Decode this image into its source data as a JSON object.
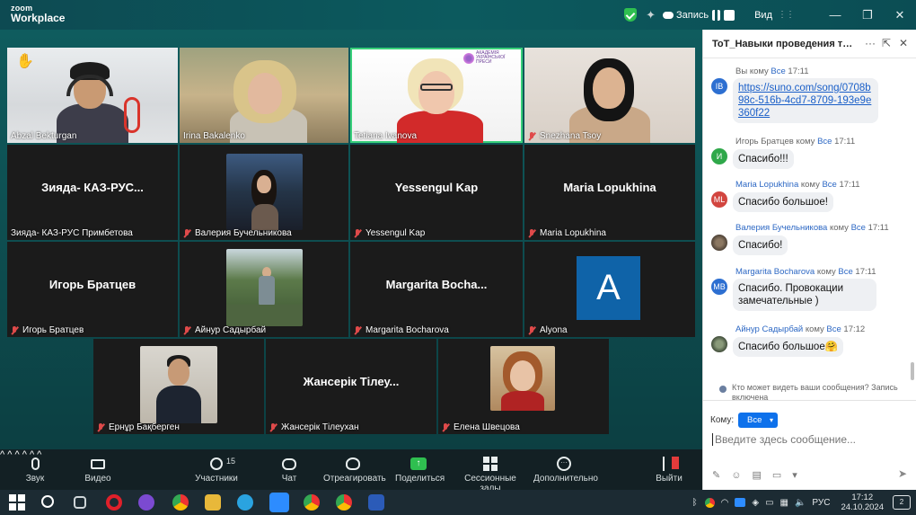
{
  "titlebar": {
    "brand_line1": "zoom",
    "brand_line2": "Workplace",
    "recording_label": "Запись",
    "view_label": "Вид"
  },
  "participants": [
    {
      "name": "Abzal Bekturgan",
      "muted": false,
      "video": true
    },
    {
      "name": "Irina Bakalenko",
      "muted": false,
      "video": true
    },
    {
      "name": "Tetiana Ivanova",
      "muted": false,
      "video": true,
      "active_speaker": true,
      "logo_text": "АКАДЕМІЯ УКРАЇНСЬКОЇ ПРЕСИ"
    },
    {
      "name": "Snezhana Tsoy",
      "muted": true,
      "video": true
    },
    {
      "name": "Зияда- КАЗ-РУС Примбетова",
      "display": "Зияда-  КАЗ-РУС...",
      "muted": false,
      "video": false
    },
    {
      "name": "Валерия Бучельникова",
      "muted": true,
      "video": true
    },
    {
      "name": "Yessengul Kap",
      "display": "Yessengul Kap",
      "muted": true,
      "video": false
    },
    {
      "name": "Maria Lopukhina",
      "display": "Maria Lopukhina",
      "muted": true,
      "video": false
    },
    {
      "name": "Игорь Братцев",
      "display": "Игорь Братцев",
      "muted": true,
      "video": false
    },
    {
      "name": "Айнур Садырбай",
      "muted": true,
      "video": true
    },
    {
      "name": "Margarita Bocharova",
      "display": "Margarita  Bocha...",
      "muted": true,
      "video": false
    },
    {
      "name": "Alyona",
      "display": "A",
      "muted": true,
      "video": false
    },
    {
      "name": "Ернұр Бақберген",
      "muted": true,
      "video": true
    },
    {
      "name": "Жансерік Тілеухан",
      "display": "Жансерік Тілеу...",
      "muted": true,
      "video": false
    },
    {
      "name": "Елена Швецова",
      "muted": true,
      "video": true
    }
  ],
  "toolbar": {
    "audio": "Звук",
    "video": "Видео",
    "participants": "Участники",
    "participants_count": "15",
    "chat": "Чат",
    "react": "Отреагировать",
    "share": "Поделиться",
    "rooms": "Сессионные залы",
    "more": "Дополнительно",
    "leave": "Выйти"
  },
  "chat": {
    "title": "ToT_Навыки проведения трени...",
    "messages": [
      {
        "from": "Вы",
        "to": "Все",
        "time": "17:11",
        "initials": "IB",
        "avatar_color": "#2d6fd1",
        "text": "https://suno.com/song/0708b98c-516b-4cd7-8709-193e9e360f22",
        "is_link": true
      },
      {
        "from": "Игорь Братцев",
        "to": "Все",
        "time": "17:11",
        "initials": "И",
        "avatar_color": "#2fa84a",
        "text": "Спасибо!!!"
      },
      {
        "from": "Maria Lopukhina",
        "to": "Все",
        "time": "17:11",
        "initials": "ML",
        "avatar_color": "#d2453f",
        "text": "Спасибо большое!"
      },
      {
        "from": "Валерия Бучельникова",
        "to": "Все",
        "time": "17:11",
        "initials": "",
        "avatar_color": "#6b5a4a",
        "text": "Спасибо!"
      },
      {
        "from": "Margarita Bocharova",
        "to": "Все",
        "time": "17:11",
        "initials": "MB",
        "avatar_color": "#2d6fd1",
        "text": "Спасибо. Провокации замечательные )"
      },
      {
        "from": "Айнур Садырбай",
        "to": "Все",
        "time": "17:12",
        "initials": "",
        "avatar_color": "#5a6b55",
        "text": "Спасибо большое🤗"
      }
    ],
    "link_lines": [
      "https://suno.com/song/0708b",
      "98c-516b-4cd7-8709-193e9e",
      "360f22"
    ],
    "bocharova_lines": [
      "Спасибо. Провокации",
      "замечательные )"
    ],
    "to_word": "кому",
    "who_sees": "Кто может видеть ваши сообщения? Запись включена",
    "to_label": "Кому:",
    "to_value": "Все",
    "placeholder": "Введите здесь сообщение..."
  },
  "taskbar": {
    "lang": "РУС",
    "time": "17:12",
    "date": "24.10.2024",
    "notifications": "2"
  }
}
